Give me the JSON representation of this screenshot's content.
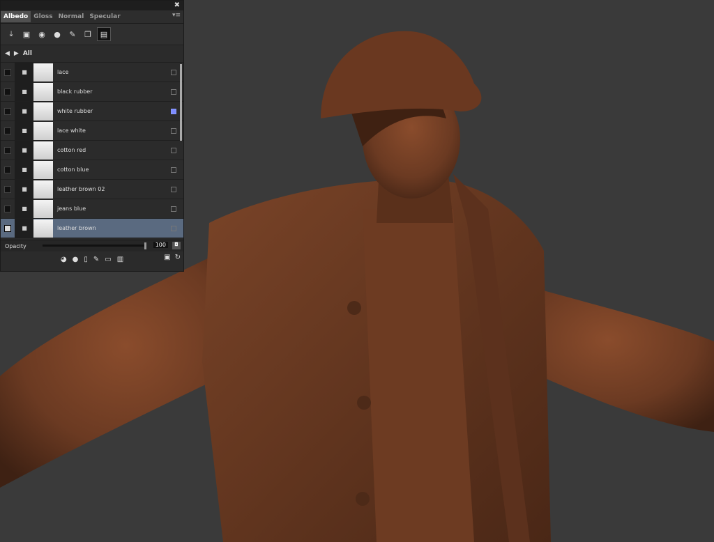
{
  "panel": {
    "tabs": [
      {
        "label": "Albedo",
        "active": true
      },
      {
        "label": "Gloss",
        "active": false
      },
      {
        "label": "Normal",
        "active": false
      },
      {
        "label": "Specular",
        "active": false
      }
    ],
    "breadcrumb": "All",
    "layers": [
      {
        "name": "lace",
        "mask_on": false,
        "selected": false
      },
      {
        "name": "black rubber",
        "mask_on": false,
        "selected": false
      },
      {
        "name": "white rubber",
        "mask_on": true,
        "selected": false
      },
      {
        "name": "lace white",
        "mask_on": false,
        "selected": false
      },
      {
        "name": "cotton red",
        "mask_on": false,
        "selected": false
      },
      {
        "name": "cotton blue",
        "mask_on": false,
        "selected": false
      },
      {
        "name": "leather brown 02",
        "mask_on": false,
        "selected": false
      },
      {
        "name": "jeans blue",
        "mask_on": false,
        "selected": false
      },
      {
        "name": "leather brown",
        "mask_on": false,
        "selected": true
      }
    ],
    "opacity_label": "Opacity",
    "opacity_value": "100"
  },
  "colors": {
    "background": "#3a3a3a",
    "selected_row": "#5a6a80",
    "mask_active": "#7d8cff",
    "model": "#6b3a22"
  },
  "icons": [
    "close-icon",
    "menu-icon",
    "download-icon",
    "new-layer-icon",
    "sphere-icon",
    "paint-icon",
    "brush-icon",
    "copy-icon",
    "layer-icon",
    "chevron-left-icon",
    "chevron-right-icon",
    "folder-icon",
    "trash-icon",
    "save-icon",
    "refresh-icon"
  ]
}
